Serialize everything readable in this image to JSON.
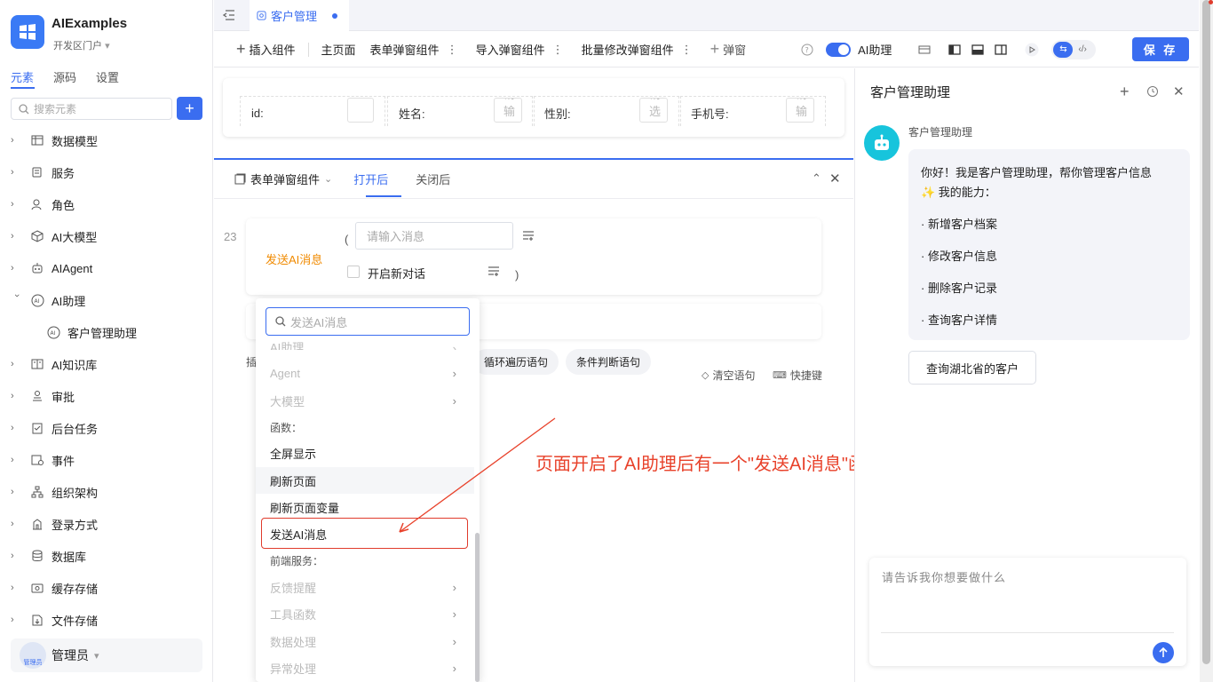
{
  "app": {
    "title": "AIExamples",
    "subtitle": "开发区门户"
  },
  "sidebar": {
    "tabs": [
      "元素",
      "源码",
      "设置"
    ],
    "search_placeholder": "搜索元素",
    "add_label": "+",
    "items": [
      {
        "label": "数据模型",
        "icon": "table-icon"
      },
      {
        "label": "服务",
        "icon": "service-icon"
      },
      {
        "label": "角色",
        "icon": "role-icon"
      },
      {
        "label": "AI大模型",
        "icon": "cube-icon"
      },
      {
        "label": "AIAgent",
        "icon": "robot-icon"
      },
      {
        "label": "AI助理",
        "icon": "ai-icon"
      },
      {
        "label": "客户管理助理",
        "icon": "ai-icon"
      },
      {
        "label": "AI知识库",
        "icon": "book-icon"
      },
      {
        "label": "审批",
        "icon": "approval-icon"
      },
      {
        "label": "后台任务",
        "icon": "task-icon"
      },
      {
        "label": "事件",
        "icon": "event-icon"
      },
      {
        "label": "组织架构",
        "icon": "org-icon"
      },
      {
        "label": "登录方式",
        "icon": "login-icon"
      },
      {
        "label": "数据库",
        "icon": "database-icon"
      },
      {
        "label": "缓存存储",
        "icon": "cache-icon"
      },
      {
        "label": "文件存储",
        "icon": "file-icon"
      }
    ],
    "user": {
      "name": "管理员",
      "avatar_text": "管理员"
    }
  },
  "tabbar": {
    "tab_label": "客户管理"
  },
  "toolbar": {
    "insert": "插入组件",
    "main_page": "主页面",
    "form_dialog": "表单弹窗组件",
    "import_dialog": "导入弹窗组件",
    "batch_dialog": "批量修改弹窗组件",
    "add_dialog": "弹窗",
    "ai_toggle": "AI助理",
    "save": "保 存"
  },
  "form": {
    "fields": [
      {
        "label": "id:",
        "placeholder": ""
      },
      {
        "label": "姓名:",
        "placeholder": "请输入"
      },
      {
        "label": "性别:",
        "placeholder": "请选择"
      },
      {
        "label": "手机号:",
        "placeholder": "请输入"
      }
    ]
  },
  "event_panel": {
    "component": "表单弹窗组件",
    "tabs": [
      "打开后",
      "关闭后"
    ],
    "line_number": "23",
    "function_name": "发送AI消息",
    "paren_open": "(",
    "paren_close": ")",
    "message_placeholder": "请输入消息",
    "new_chat_label": "开启新对话",
    "insert_prefix": "插",
    "chips": [
      "循环遍历语句",
      "条件判断语句"
    ],
    "clear": "清空语句",
    "shortcut": "快捷键"
  },
  "dropdown": {
    "search_placeholder": "发送AI消息",
    "partial_top": "AI助理",
    "items": [
      {
        "label": "Agent",
        "type": "grey-sub"
      },
      {
        "label": "大模型",
        "type": "grey-sub"
      },
      {
        "label": "函数：",
        "type": "header"
      },
      {
        "label": "全屏显示",
        "type": "item"
      },
      {
        "label": "刷新页面",
        "type": "hover"
      },
      {
        "label": "刷新页面变量",
        "type": "item"
      },
      {
        "label": "发送AI消息",
        "type": "item"
      },
      {
        "label": "前端服务：",
        "type": "header"
      },
      {
        "label": "反馈提醒",
        "type": "grey-sub"
      },
      {
        "label": "工具函数",
        "type": "grey-sub"
      },
      {
        "label": "数据处理",
        "type": "grey-sub"
      },
      {
        "label": "异常处理",
        "type": "grey-sub"
      }
    ]
  },
  "annotation": "页面开启了AI助理后有一个\"发送AI消息\"函数",
  "assistant": {
    "title": "客户管理助理",
    "bot_name": "客户管理助理",
    "greeting": "你好！我是客户管理助理，帮你管理客户信息",
    "ability_title": "✨ 我的能力：",
    "abilities": [
      "· 新增客户档案",
      "· 修改客户信息",
      "· 删除客户记录",
      "· 查询客户详情"
    ],
    "quick_question": "查询湖北省的客户",
    "input_placeholder": "请告诉我你想要做什么"
  },
  "colors": {
    "accent": "#3a6df0",
    "annotation": "#e8412a",
    "bot": "#17c4dc",
    "function": "#f08a00"
  }
}
